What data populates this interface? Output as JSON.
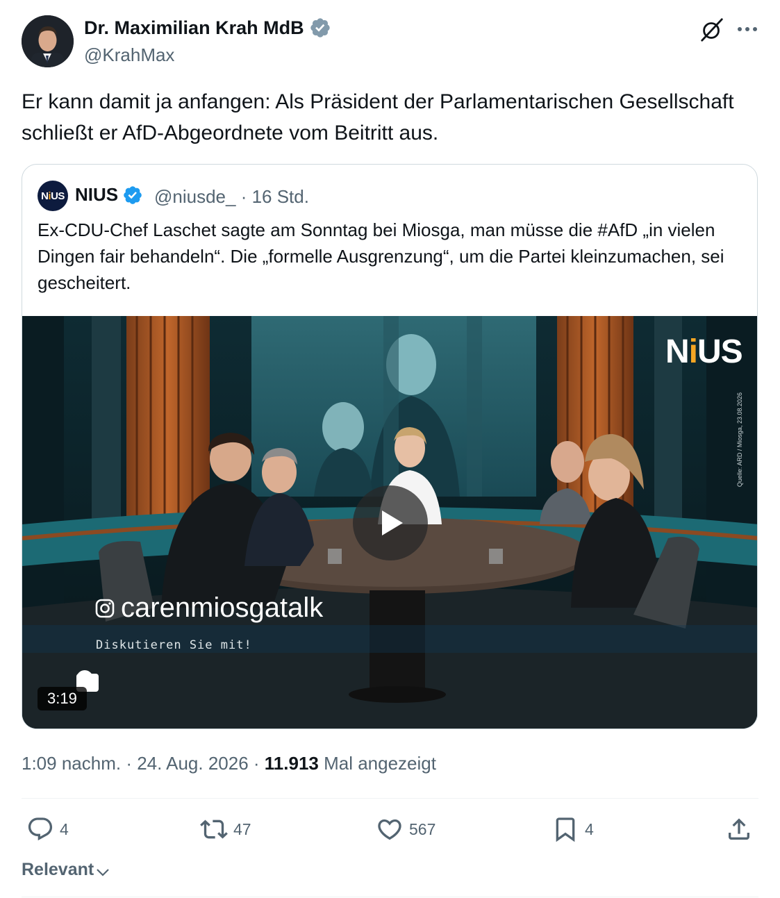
{
  "author": {
    "name": "Dr. Maximilian Krah MdB",
    "handle": "@KrahMax"
  },
  "tweet": {
    "text": "Er kann damit ja anfangen: Als Präsident der Parlamentarischen Gesellschaft schließt er AfD-Abgeordnete vom Beitritt aus."
  },
  "quote": {
    "avatar_text_a": "N",
    "avatar_text_i": "i",
    "avatar_text_b": "US",
    "name": "NIUS",
    "handle_time": "@niusde_ · 16 Std.",
    "text": "Ex-CDU-Chef Laschet sagte am Sonntag bei Miosga, man müsse die #AfD „in vielen Dingen fair behandeln“. Die „formelle Ausgrenzung“, um die Partei kleinzumachen, sei gescheitert."
  },
  "video": {
    "duration": "3:19",
    "instagram_handle": "carenmiosgatalk",
    "discuss_text": "Diskutieren Sie mit!",
    "logo_a": "N",
    "logo_i": "i",
    "logo_b": "US",
    "source_text": "Quelle: ARD / Miosga, 23.08.2026"
  },
  "meta": {
    "time_date": "1:09 nachm. · 24. Aug. 2026 · ",
    "views_count": "11.913",
    "views_label": " Mal angezeigt"
  },
  "actions": {
    "replies": "4",
    "reposts": "47",
    "likes": "567",
    "bookmarks": "4"
  },
  "sort": {
    "label": "Relevant"
  },
  "colors": {
    "text_primary": "#0f1419",
    "text_secondary": "#536471",
    "verified_blue": "#1d9bf0",
    "verified_gray": "#829aab",
    "border": "#cfd9de",
    "nius_accent": "#f5a623"
  },
  "icons": {
    "author_verified": "verified-gray-badge-icon",
    "quote_verified": "verified-blue-badge-icon",
    "grok": "grok-icon",
    "more": "more-dots-icon",
    "reply": "reply-bubble-icon",
    "repost": "repost-icon",
    "like": "heart-icon",
    "bookmark": "bookmark-icon",
    "share": "share-upload-icon",
    "play": "play-icon",
    "instagram": "instagram-icon",
    "chevron": "chevron-down-icon"
  }
}
